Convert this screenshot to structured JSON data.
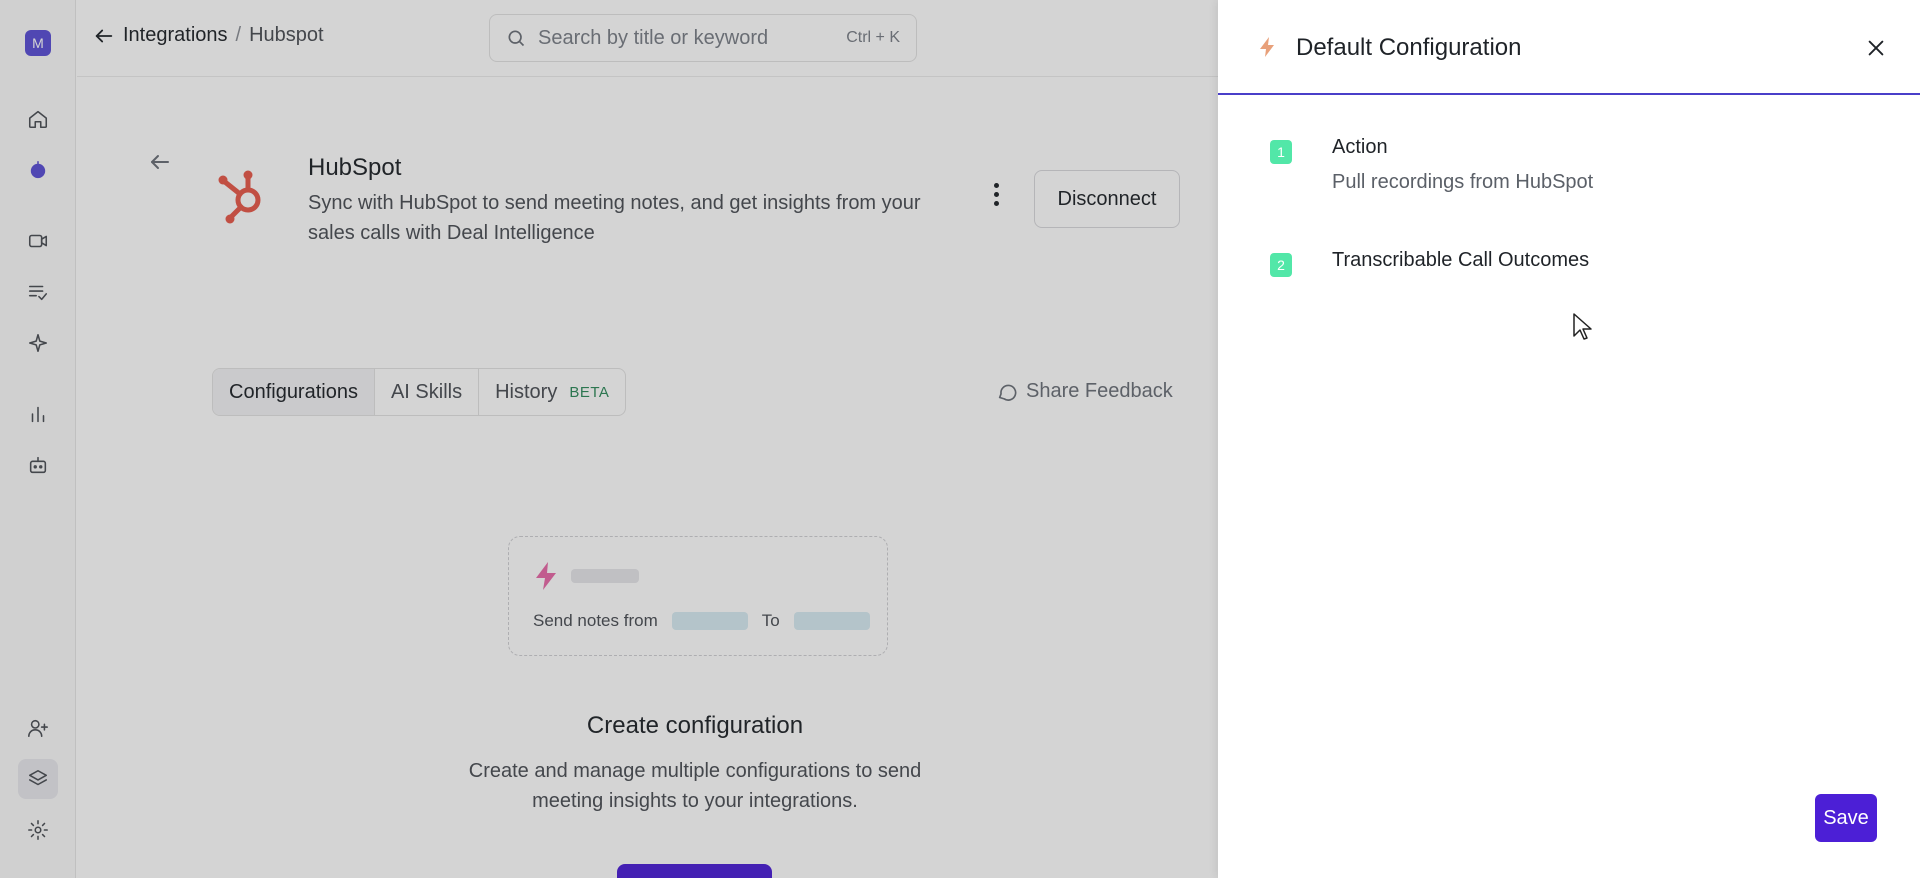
{
  "workspace": {
    "initial": "M"
  },
  "sidebar": {
    "items": [
      {
        "name": "home-icon"
      },
      {
        "name": "bot-avatar-icon"
      },
      {
        "name": "video-icon"
      },
      {
        "name": "checklist-icon"
      },
      {
        "name": "sparkle-icon"
      },
      {
        "name": "bar-chart-icon"
      },
      {
        "name": "robot-icon"
      },
      {
        "name": "add-user-icon"
      },
      {
        "name": "layers-icon",
        "active": true
      },
      {
        "name": "gear-icon"
      }
    ]
  },
  "header": {
    "breadcrumb": {
      "parent": "Integrations",
      "separator": "/",
      "current": "Hubspot"
    },
    "search": {
      "placeholder": "Search by title or keyword",
      "shortcut": "Ctrl + K"
    }
  },
  "integration": {
    "name": "HubSpot",
    "description": "Sync with HubSpot to send meeting notes, and get insights from your sales calls with Deal Intelligence",
    "disconnect_label": "Disconnect",
    "logo_color": "#e8594a"
  },
  "tabs": [
    {
      "label": "Configurations",
      "active": true
    },
    {
      "label": "AI Skills"
    },
    {
      "label": "History",
      "badge": "BETA"
    }
  ],
  "feedback_label": "Share Feedback",
  "preview": {
    "from_label": "Send notes from",
    "to_label": "To"
  },
  "empty_state": {
    "title": "Create configuration",
    "description": "Create and manage multiple configurations to send meeting insights to your integrations."
  },
  "drawer": {
    "title": "Default Configuration",
    "steps": [
      {
        "number": "1",
        "title": "Action",
        "subtitle": "Pull recordings from HubSpot"
      },
      {
        "number": "2",
        "title": "Transcribable Call Outcomes"
      }
    ],
    "save_label": "Save"
  },
  "colors": {
    "accent": "#4c1fd6",
    "step_badge": "#52e7a8",
    "header_underline": "#4a3fc9",
    "beta_badge": "#2e8a5b",
    "bolt": "#e86aa8"
  }
}
